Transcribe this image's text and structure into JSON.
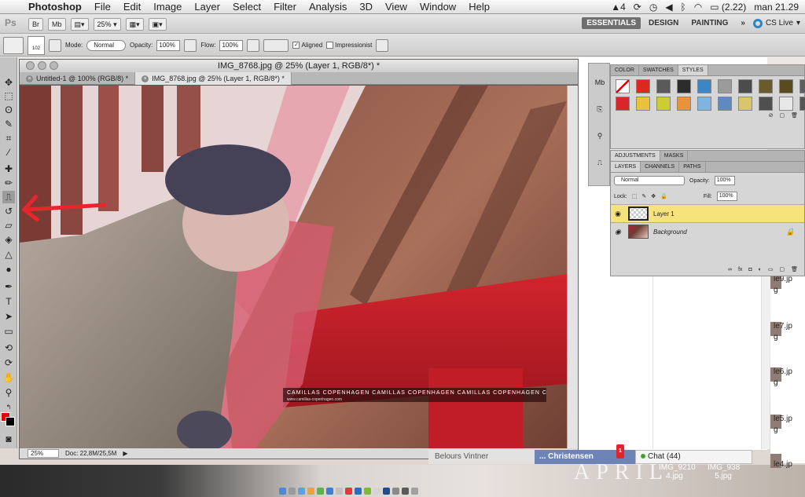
{
  "menubar": {
    "app_name": "Photoshop",
    "items": [
      "File",
      "Edit",
      "Image",
      "Layer",
      "Select",
      "Filter",
      "Analysis",
      "3D",
      "View",
      "Window",
      "Help"
    ],
    "status": {
      "adobe_badge": "4",
      "battery": "(2.22)",
      "clock": "man 21.29"
    }
  },
  "appbar": {
    "bridge_label": "Br",
    "minibridge_label": "Mb",
    "zoom": "25%",
    "workspaces": [
      "ESSENTIALS",
      "DESIGN",
      "PAINTING"
    ],
    "more": "»",
    "cs_live": "CS Live"
  },
  "options": {
    "brush_size": "102",
    "mode_label": "Mode:",
    "mode_value": "Normal",
    "opacity_label": "Opacity:",
    "opacity_value": "100%",
    "flow_label": "Flow:",
    "flow_value": "100%",
    "aligned_label": "Aligned",
    "impressionist_label": "Impressionist"
  },
  "document": {
    "window_title": "IMG_8768.jpg @ 25% (Layer 1, RGB/8*) *",
    "tabs": [
      {
        "label": "Untitled-1 @ 100% (RGB/8) *",
        "active": false
      },
      {
        "label": "IMG_8768.jpg @ 25% (Layer 1, RGB/8*) *",
        "active": true
      }
    ],
    "status_zoom": "25%",
    "status_doc": "Doc: 22,8M/25,5M",
    "watermark": "CAMILLAS COPENHAGEN   CAMILLAS COPENHAGEN   CAMILLAS COPENHAGEN   CAMILLAS C",
    "watermark_sub": "www.camillas-copenhagen.com"
  },
  "styles_panel": {
    "tabs": [
      "COLOR",
      "SWATCHES",
      "STYLES"
    ],
    "swatches": [
      "#ffffff",
      "#d92b1d",
      "#5a5a5a",
      "#2c2c2c",
      "#3d86c6",
      "#9b9b9b",
      "#4c4c4c",
      "#6b5a2c",
      "#5b4a1f",
      "#5e5e5e",
      "#d8262a",
      "#e8c23b",
      "#cccc33",
      "#e89339",
      "#7fb3e1",
      "#5e8ac0",
      "#d9c56b",
      "#4f4f4f",
      "#e8e8e8",
      "#555555"
    ]
  },
  "adjustments_panel": {
    "tabs": [
      "ADJUSTMENTS",
      "MASKS"
    ]
  },
  "layers_panel": {
    "tabs": [
      "LAYERS",
      "CHANNELS",
      "PATHS"
    ],
    "blend_mode": "Normal",
    "opacity_label": "Opacity:",
    "opacity_value": "100%",
    "lock_label": "Lock:",
    "fill_label": "Fill:",
    "fill_value": "100%",
    "layers": [
      {
        "name": "Layer 1",
        "selected": true
      },
      {
        "name": "Background",
        "selected": false
      }
    ]
  },
  "browser": {
    "file_list": [
      "le9.jp",
      "g",
      "le7.jp",
      "g",
      "le6.jp",
      "g",
      "le5.jp",
      "g",
      "le4.jp"
    ],
    "chat_tab_a": "Belours Vintner",
    "chat_tab_b": "... Christensen",
    "chat_badge": "1",
    "chat_tab_c": "Chat (44)",
    "desktop_files": [
      "IMG_9210\n4.jpg",
      "IMG_938\n5.jpg"
    ],
    "desktop_text": "APRIL"
  }
}
